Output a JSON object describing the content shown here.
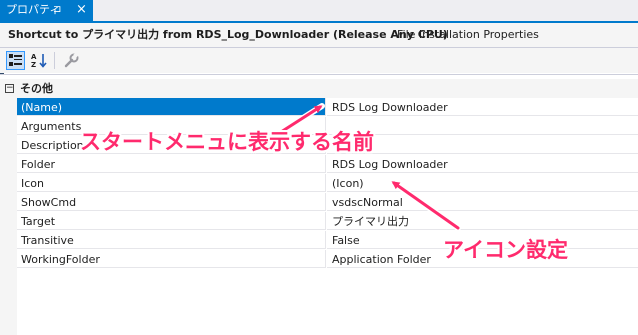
{
  "tab": {
    "title": "プロパティ",
    "pin": "⊐",
    "close": "×"
  },
  "selector": {
    "object": "Shortcut to プライマリ出力 from RDS_Log_Downloader (Release Any CPU)",
    "type": "File Installation Properties"
  },
  "toolbar": {
    "icons": [
      "categorized-icon",
      "alphabetical-icon",
      "property-pages-icon"
    ]
  },
  "category": {
    "toggle": "−",
    "name": "その他"
  },
  "properties": [
    {
      "name": "(Name)",
      "value": "RDS Log Downloader"
    },
    {
      "name": "Arguments",
      "value": ""
    },
    {
      "name": "Description",
      "value": ""
    },
    {
      "name": "Folder",
      "value": "RDS Log Downloader"
    },
    {
      "name": "Icon",
      "value": "(Icon)"
    },
    {
      "name": "ShowCmd",
      "value": "vsdscNormal"
    },
    {
      "name": "Target",
      "value": "プライマリ出力"
    },
    {
      "name": "Transitive",
      "value": "False"
    },
    {
      "name": "WorkingFolder",
      "value": "Application Folder"
    }
  ],
  "annotations": {
    "name_callout": "スタートメニュに表示する名前",
    "icon_callout": "アイコン設定"
  },
  "colors": {
    "accent": "#007acc",
    "annotation": "#ff2a6d"
  }
}
